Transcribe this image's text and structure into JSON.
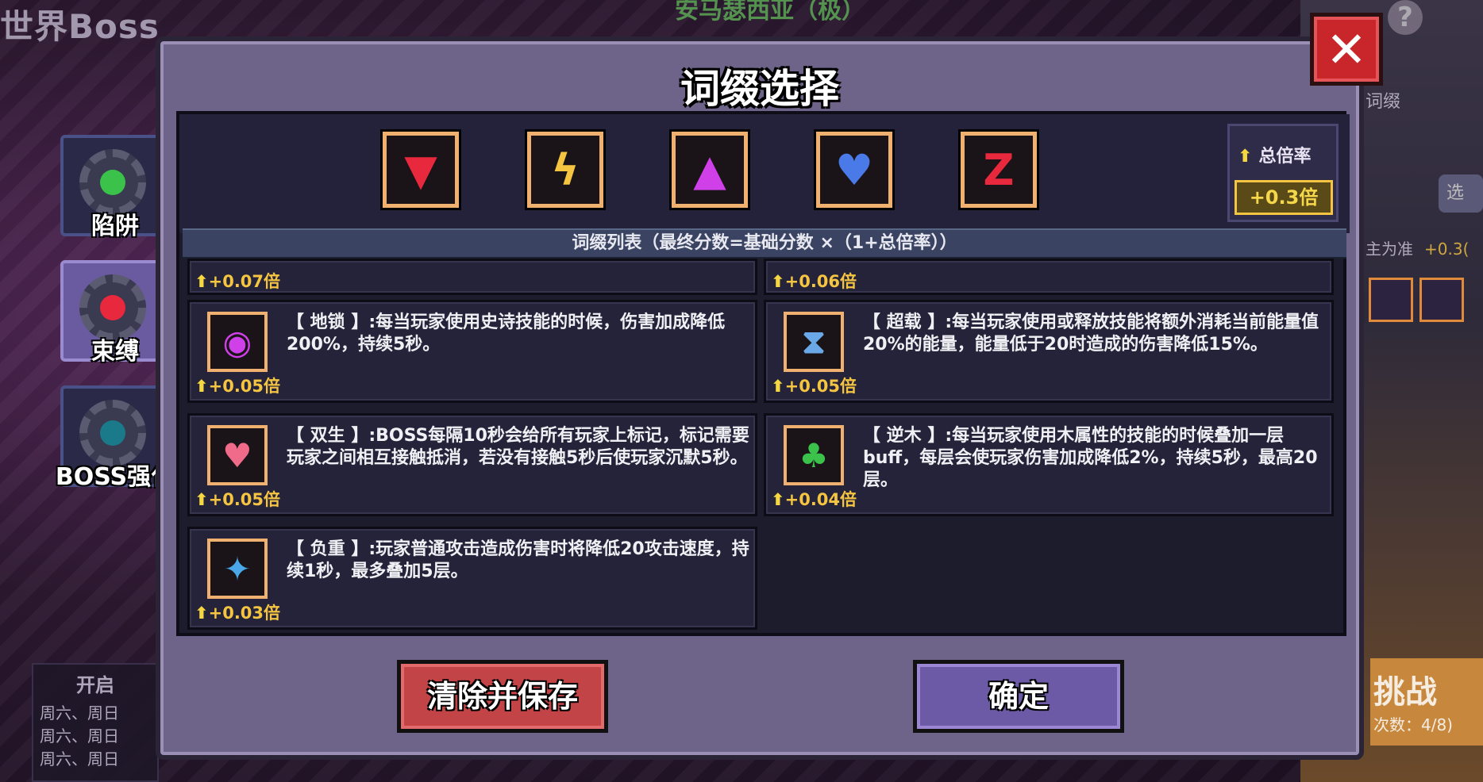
{
  "background": {
    "title": "世界Boss",
    "subtitle": "安马瑟西亚（极）",
    "help_icon": "?",
    "right_tab_label": "词缀",
    "right_select_label": "选",
    "right_rule_text": "主为准",
    "right_rule_value": "+0.3(",
    "challenge_label": "挑战",
    "challenge_count": "次数：4/8)",
    "schedule_header": "开启",
    "schedule_rows": [
      "周六、周日",
      "周六、周日",
      "周六、周日"
    ]
  },
  "side_tabs": [
    {
      "label": "陷阱",
      "icon": "trap-gear-icon",
      "active": false
    },
    {
      "label": "束缚",
      "icon": "bind-gear-icon",
      "active": true
    },
    {
      "label": "BOSS强化",
      "icon": "boss-enhance-gear-icon",
      "active": false
    }
  ],
  "modal": {
    "title": "词缀选择",
    "close_icon": "close-icon",
    "selected_affixes": [
      {
        "icon": "down-arrow-icon",
        "color": "#e8283c"
      },
      {
        "icon": "lightning-icon",
        "color": "#f5c542"
      },
      {
        "icon": "up-arrow-icon",
        "color": "#d040e8"
      },
      {
        "icon": "broken-heart-icon",
        "color": "#4a7ae8"
      },
      {
        "icon": "red-rune-icon",
        "color": "#e8283c"
      }
    ],
    "multiplier": {
      "label": "总倍率",
      "value": "+0.3倍"
    },
    "formula": "词缀列表（最终分数=基础分数 ×（1+总倍率））",
    "affix_list": [
      {
        "bonus": "+0.07倍",
        "desc": "",
        "icon": "",
        "color": "#000"
      },
      {
        "bonus": "+0.06倍",
        "desc": "",
        "icon": "",
        "color": "#000"
      },
      {
        "name_desc": "【 地锁 】:每当玩家使用史诗技能的时候，伤害加成降低200%，持续5秒。",
        "bonus": "+0.05倍",
        "icon": "ground-lock-icon",
        "color": "#d040e8"
      },
      {
        "name_desc": "【 超载 】:每当玩家使用或释放技能将额外消耗当前能量值20%的能量，能量低于20时造成的伤害降低15%。",
        "bonus": "+0.05倍",
        "icon": "hourglass-icon",
        "color": "#6aa8e8"
      },
      {
        "name_desc": "【 双生 】:BOSS每隔10秒会给所有玩家上标记，标记需要玩家之间相互接触抵消，若没有接触5秒后使玩家沉默5秒。",
        "bonus": "+0.05倍",
        "icon": "heart-split-icon",
        "color": "#f06a8a"
      },
      {
        "name_desc": "【 逆木 】:每当玩家使用木属性的技能的时候叠加一层buff，每层会使玩家伤害加成降低2%，持续5秒，最高20层。",
        "bonus": "+0.04倍",
        "icon": "tree-icon",
        "color": "#3ac24a"
      },
      {
        "name_desc": "【 负重 】:玩家普通攻击造成伤害时将降低20攻击速度，持续1秒，最多叠加5层。",
        "bonus": "+0.03倍",
        "icon": "weight-icon",
        "color": "#4aa8e8"
      }
    ],
    "buttons": {
      "clear": "清除并保存",
      "confirm": "确定"
    }
  }
}
